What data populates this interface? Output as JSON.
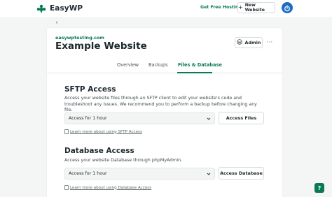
{
  "header": {
    "brand_name": "EasyWP",
    "free_hosting_link": "Get Free Hosting",
    "new_website_label": "New Website",
    "new_website_icon": "plus-icon",
    "user_icon": "power-icon"
  },
  "site": {
    "domain": "easywptesting.com",
    "title": "Example Website",
    "admin_label": "Admin",
    "admin_icon": "wordpress-icon",
    "more_label": "···"
  },
  "tabs": [
    {
      "label": "Overview",
      "active": false
    },
    {
      "label": "Backups",
      "active": false
    },
    {
      "label": "Files & Database",
      "active": true
    }
  ],
  "sftp": {
    "title": "SFTP Access",
    "description": "Access your website files through an SFTP client to edit your website's code and troubleshoot any issues. We recommend you to perform a backup before changing any file.",
    "duration_selected": "Access for 1 hour",
    "button_label": "Access Files",
    "learn_more": "Learn more about using SFTP Access"
  },
  "database": {
    "title": "Database Access",
    "description": "Access your website Database through phpMyAdmin.",
    "duration_selected": "Access for 1 hour",
    "button_label": "Access Database",
    "learn_more": "Learn more about using Database Access"
  },
  "help": {
    "label": "?"
  },
  "colors": {
    "accent": "#0a7a52",
    "user_button": "#1c6ec2",
    "background": "#f4f5f5"
  }
}
